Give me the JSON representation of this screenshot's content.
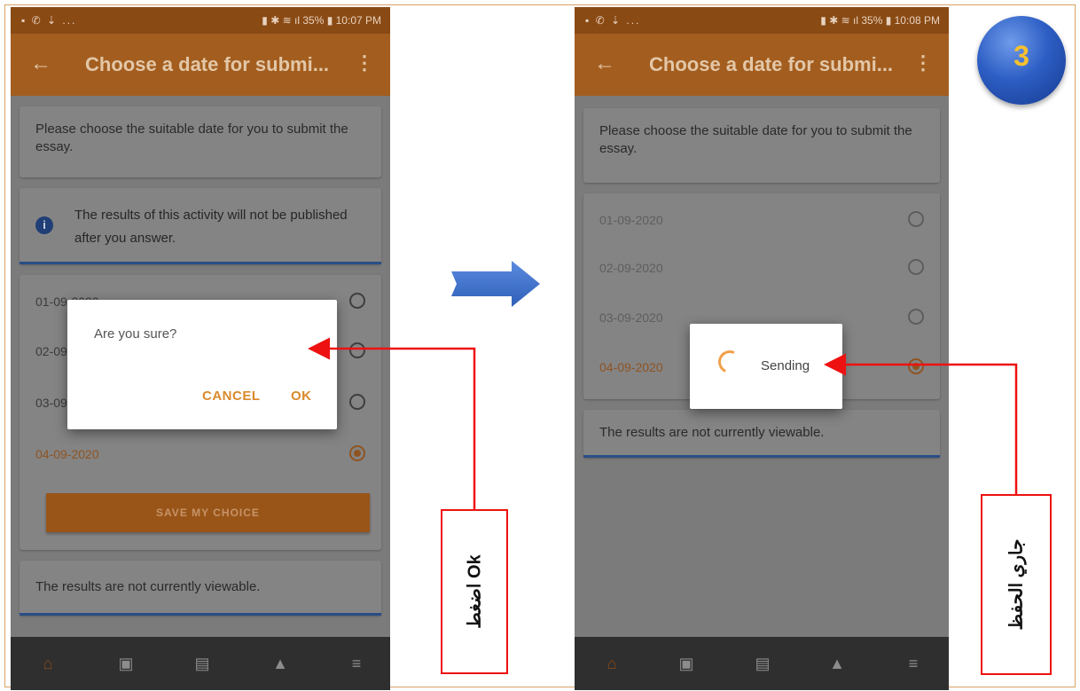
{
  "panel_left": {
    "status": {
      "left": "▪ ✆ ⇣ ...",
      "right": "▮ ✱ ≋ ıl 35% ▮ 10:07 PM"
    },
    "title": "Choose a date for submi...",
    "instruction": "Please choose the suitable date for you to submit the essay.",
    "notice": "The results of this activity will not be published after you answer.",
    "options": [
      {
        "label": "01-09-2020",
        "selected": false
      },
      {
        "label": "02-09-2020",
        "selected": false
      },
      {
        "label": "03-09-2020",
        "selected": false
      },
      {
        "label": "04-09-2020",
        "selected": true
      }
    ],
    "save_label": "SAVE MY CHOICE",
    "results_text": "The results are not currently viewable.",
    "dialog": {
      "message": "Are you sure?",
      "cancel_label": "CANCEL",
      "ok_label": "OK"
    },
    "nav": [
      "home-icon",
      "calendar-icon",
      "messages-icon",
      "notifications-icon",
      "menu-icon"
    ]
  },
  "panel_right": {
    "status": {
      "left": "▪ ✆ ⇣ ...",
      "right": "▮ ✱ ≋ ıl 35% ▮ 10:08 PM"
    },
    "title": "Choose a date for submi...",
    "instruction": "Please choose the suitable date for you to submit the essay.",
    "options": [
      {
        "label": "01-09-2020",
        "selected": false
      },
      {
        "label": "02-09-2020",
        "selected": false
      },
      {
        "label": "03-09-2020",
        "selected": false
      },
      {
        "label": "04-09-2020",
        "selected": true
      }
    ],
    "results_text": "The results are not currently viewable.",
    "sending_text": "Sending",
    "nav": [
      "home-icon",
      "calendar-icon",
      "messages-icon",
      "notifications-icon",
      "menu-icon"
    ]
  },
  "annotations": {
    "step_number": "3",
    "callout_ok": "اضغط Ok",
    "callout_saving": "جاري الحفظ"
  },
  "colors": {
    "accent": "#a35e1f",
    "dialog_button": "#d98a2b",
    "callout": "#ee1111",
    "arrow": "#3f73c9"
  }
}
